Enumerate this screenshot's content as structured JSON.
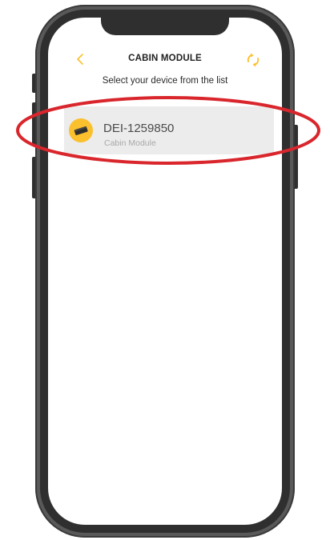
{
  "header": {
    "title": "CABIN MODULE",
    "back_icon": "chevron-left-icon",
    "refresh_icon": "refresh-icon"
  },
  "subtitle": "Select your device from the list",
  "devices": [
    {
      "name": "DEI-1259850",
      "type": "Cabin Module",
      "icon": "cabin-module-icon"
    }
  ],
  "colors": {
    "accent": "#fbc02d",
    "highlight": "#d9262c",
    "list_bg": "#ececec",
    "frame": "#595959"
  }
}
